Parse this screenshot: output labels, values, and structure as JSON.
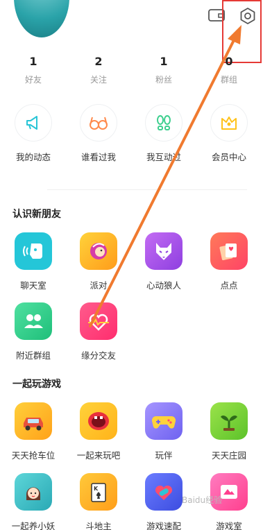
{
  "header": {
    "wallet_icon": "wallet-icon",
    "settings_icon": "gear-icon"
  },
  "stats": [
    {
      "count": "1",
      "label": "好友"
    },
    {
      "count": "2",
      "label": "关注"
    },
    {
      "count": "1",
      "label": "粉丝"
    },
    {
      "count": "0",
      "label": "群组"
    }
  ],
  "quick_actions": [
    {
      "label": "我的动态",
      "icon": "megaphone-icon",
      "color": "#29c5d6"
    },
    {
      "label": "谁看过我",
      "icon": "glasses-icon",
      "color": "#ff8a4c"
    },
    {
      "label": "我互动过",
      "icon": "footprints-icon",
      "color": "#3ccf8e"
    },
    {
      "label": "会员中心",
      "icon": "crown-icon",
      "color": "#ffc21a"
    }
  ],
  "sections": {
    "new_friends": {
      "title": "认识新朋友",
      "items": [
        {
          "label": "聊天室",
          "icon": "chat-room-icon",
          "color": "#24c6d8"
        },
        {
          "label": "派对",
          "icon": "party-icon",
          "color": "#ffb41f"
        },
        {
          "label": "心动狼人",
          "icon": "wolf-icon",
          "color": "#a659e8"
        },
        {
          "label": "点点",
          "icon": "cards-icon",
          "color": "#ff5a5f"
        },
        {
          "label": "附近群组",
          "icon": "nearby-group-icon",
          "color": "#2ecf8b"
        },
        {
          "label": "缘分交友",
          "icon": "heart-icon",
          "color": "#ff3d7f"
        }
      ]
    },
    "games": {
      "title": "一起玩游戏",
      "items": [
        {
          "label": "天天抢车位",
          "icon": "car-icon",
          "color": "#ffb21f"
        },
        {
          "label": "一起来玩吧",
          "icon": "mouth-icon",
          "color": "#ffc21a"
        },
        {
          "label": "玩伴",
          "icon": "gamepad-icon",
          "color": "#8b7cf6"
        },
        {
          "label": "天天庄园",
          "icon": "sprout-icon",
          "color": "#7bd23a"
        },
        {
          "label": "一起养小妖",
          "icon": "girl-icon",
          "color": "#39c2c9"
        },
        {
          "label": "斗地主",
          "icon": "poker-icon",
          "color": "#ffb21f"
        },
        {
          "label": "游戏速配",
          "icon": "heart-gamepad-icon",
          "color": "#5b6bf5"
        },
        {
          "label": "游戏室",
          "icon": "game-room-icon",
          "color": "#ff5fa2"
        }
      ]
    }
  },
  "annotation": {
    "color": "#f07a2f",
    "box_color": "#e53935"
  },
  "watermark": "Baidu经验"
}
